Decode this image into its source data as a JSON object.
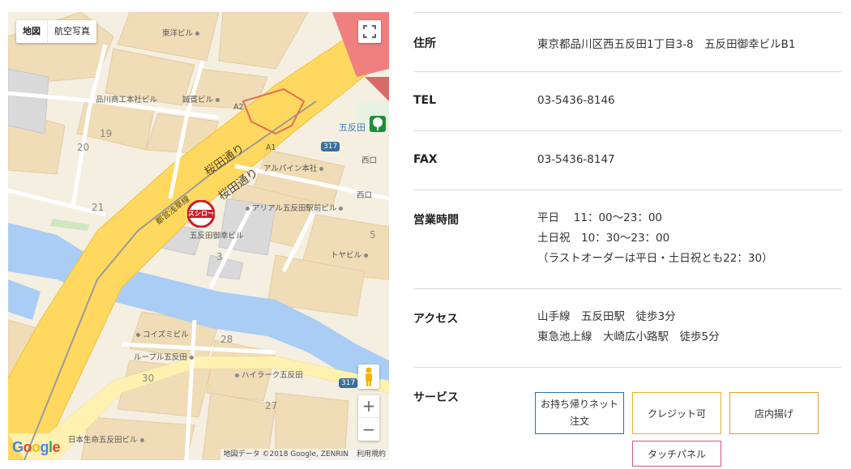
{
  "map": {
    "type_buttons": [
      "地図",
      "航空写真"
    ],
    "road_labels": [
      "桜田通り",
      "桜田通り",
      "都営浅草線"
    ],
    "place_labels": [
      "東洋ビル",
      "品川商工本社ビル",
      "誠賓ビル",
      "アルパイン本社",
      "アリアル五反田駅前ビル",
      "五反田御幸ビル",
      "トヤビル",
      "コイズミビル",
      "ループル五反田",
      "ハイラーク五反田",
      "日本生命五反田ビル",
      "五反田",
      "西口",
      "西口"
    ],
    "block_numbers": [
      "19",
      "20",
      "21",
      "3",
      "5",
      "28",
      "30",
      "27"
    ],
    "route_numbers": [
      "317",
      "317"
    ],
    "exit_labels": [
      "A2",
      "A1"
    ],
    "store_marker": "スシロー",
    "zoom_in": "+",
    "zoom_out": "−",
    "attribution": [
      "地図データ ©2018 Google, ZENRIN",
      "利用規約"
    ],
    "logo": "Google"
  },
  "info": {
    "address": {
      "label": "住所",
      "value": "東京都品川区西五反田1丁目3-8　五反田御幸ビルB1"
    },
    "tel": {
      "label": "TEL",
      "value": "03-5436-8146"
    },
    "fax": {
      "label": "FAX",
      "value": "03-5436-8147"
    },
    "hours": {
      "label": "営業時間",
      "lines": [
        "平日　 11：00〜23：00",
        "土日祝　10：30〜23：00",
        "（ラストオーダーは平日・土日祝とも22：30）"
      ]
    },
    "access": {
      "label": "アクセス",
      "lines": [
        "山手線　五反田駅　徒歩3分",
        "東急池上線　大崎広小路駅　徒歩5分"
      ]
    },
    "services": {
      "label": "サービス",
      "buttons": [
        {
          "label": "お持ち帰りネット注文",
          "color": "#2f6fa8"
        },
        {
          "label": "クレジット可",
          "color": "#e0b030"
        },
        {
          "label": "店内揚げ",
          "color": "#e0a030"
        },
        {
          "label": "タッチパネル",
          "color": "#d05a7a"
        }
      ]
    }
  }
}
